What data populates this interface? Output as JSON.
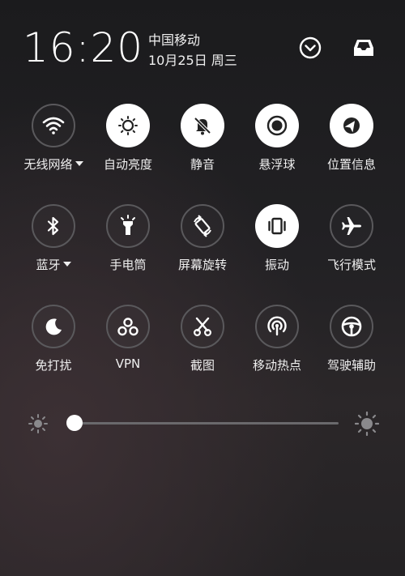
{
  "status": {
    "time": "16:20",
    "carrier": "中国移动",
    "date": "10月25日 周三"
  },
  "header": {
    "expand_icon": "chevron-down-circle-icon",
    "inbox_icon": "inbox-icon"
  },
  "toggles": [
    {
      "label": "无线网络",
      "icon": "wifi-icon",
      "state": "off",
      "dropdown": true
    },
    {
      "label": "自动亮度",
      "icon": "brightness-icon",
      "state": "on",
      "dropdown": false
    },
    {
      "label": "静音",
      "icon": "bell-off-icon",
      "state": "on",
      "dropdown": false
    },
    {
      "label": "悬浮球",
      "icon": "floating-ball-icon",
      "state": "on",
      "dropdown": false
    },
    {
      "label": "位置信息",
      "icon": "location-icon",
      "state": "on",
      "dropdown": false
    },
    {
      "label": "蓝牙",
      "icon": "bluetooth-icon",
      "state": "off",
      "dropdown": true
    },
    {
      "label": "手电筒",
      "icon": "flashlight-icon",
      "state": "off",
      "dropdown": false
    },
    {
      "label": "屏幕旋转",
      "icon": "rotate-screen-icon",
      "state": "off",
      "dropdown": false
    },
    {
      "label": "振动",
      "icon": "vibrate-icon",
      "state": "on",
      "dropdown": false
    },
    {
      "label": "飞行模式",
      "icon": "airplane-icon",
      "state": "off",
      "dropdown": false
    },
    {
      "label": "免打扰",
      "icon": "moon-icon",
      "state": "off",
      "dropdown": false
    },
    {
      "label": "VPN",
      "icon": "vpn-icon",
      "state": "off",
      "dropdown": false
    },
    {
      "label": "截图",
      "icon": "scissors-icon",
      "state": "off",
      "dropdown": false
    },
    {
      "label": "移动热点",
      "icon": "hotspot-icon",
      "state": "off",
      "dropdown": false
    },
    {
      "label": "驾驶辅助",
      "icon": "steering-wheel-icon",
      "state": "off",
      "dropdown": false
    }
  ],
  "brightness": {
    "level": 0.0
  },
  "colors": {
    "on_bg": "#ffffff",
    "on_icon": "#222222",
    "off_border": "#5a595c",
    "off_icon": "#ffffff"
  }
}
